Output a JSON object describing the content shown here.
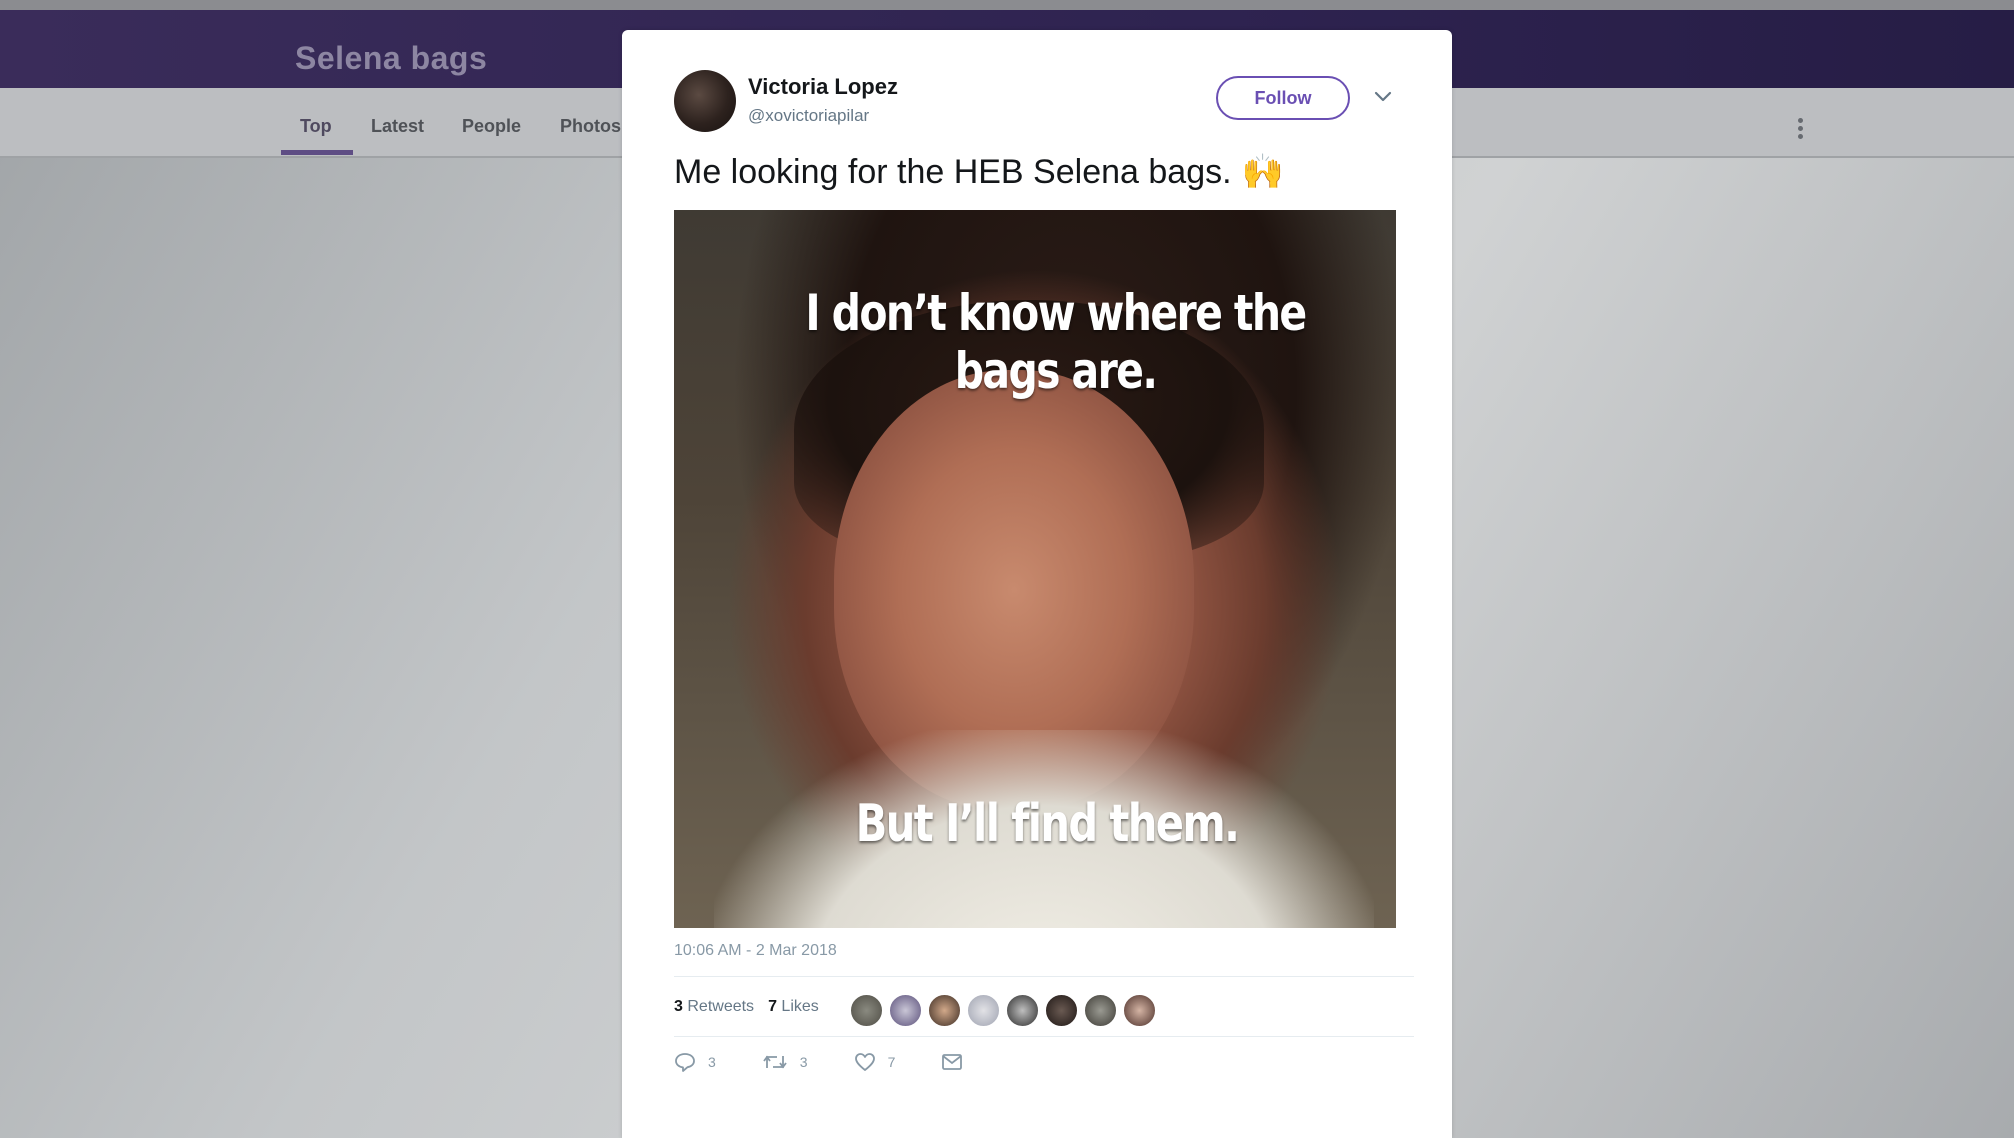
{
  "header": {
    "search_title": "Selena bags"
  },
  "nav": {
    "tabs": [
      {
        "label": "Top",
        "active": true
      },
      {
        "label": "Latest",
        "active": false
      },
      {
        "label": "People",
        "active": false
      },
      {
        "label": "Photos",
        "active": false
      }
    ],
    "more_icon": "more-vertical-icon"
  },
  "tweet": {
    "user_name": "Victoria Lopez",
    "handle": "@xovictoriapilar",
    "follow_label": "Follow",
    "text": "Me looking for the HEB Selena bags.",
    "emoji": "🙌",
    "media": {
      "caption_top": "I don’t know where the bags are.",
      "caption_bottom": "But I’ll find them."
    },
    "timestamp": "10:06 AM - 2 Mar 2018",
    "retweets_count": "3",
    "retweets_label": "Retweets",
    "likes_count": "7",
    "likes_label": "Likes",
    "actions": {
      "reply_count": "3",
      "retweet_count": "3",
      "like_count": "7"
    }
  },
  "colors": {
    "header": "#2e2350",
    "accent": "#6a4fb3"
  }
}
